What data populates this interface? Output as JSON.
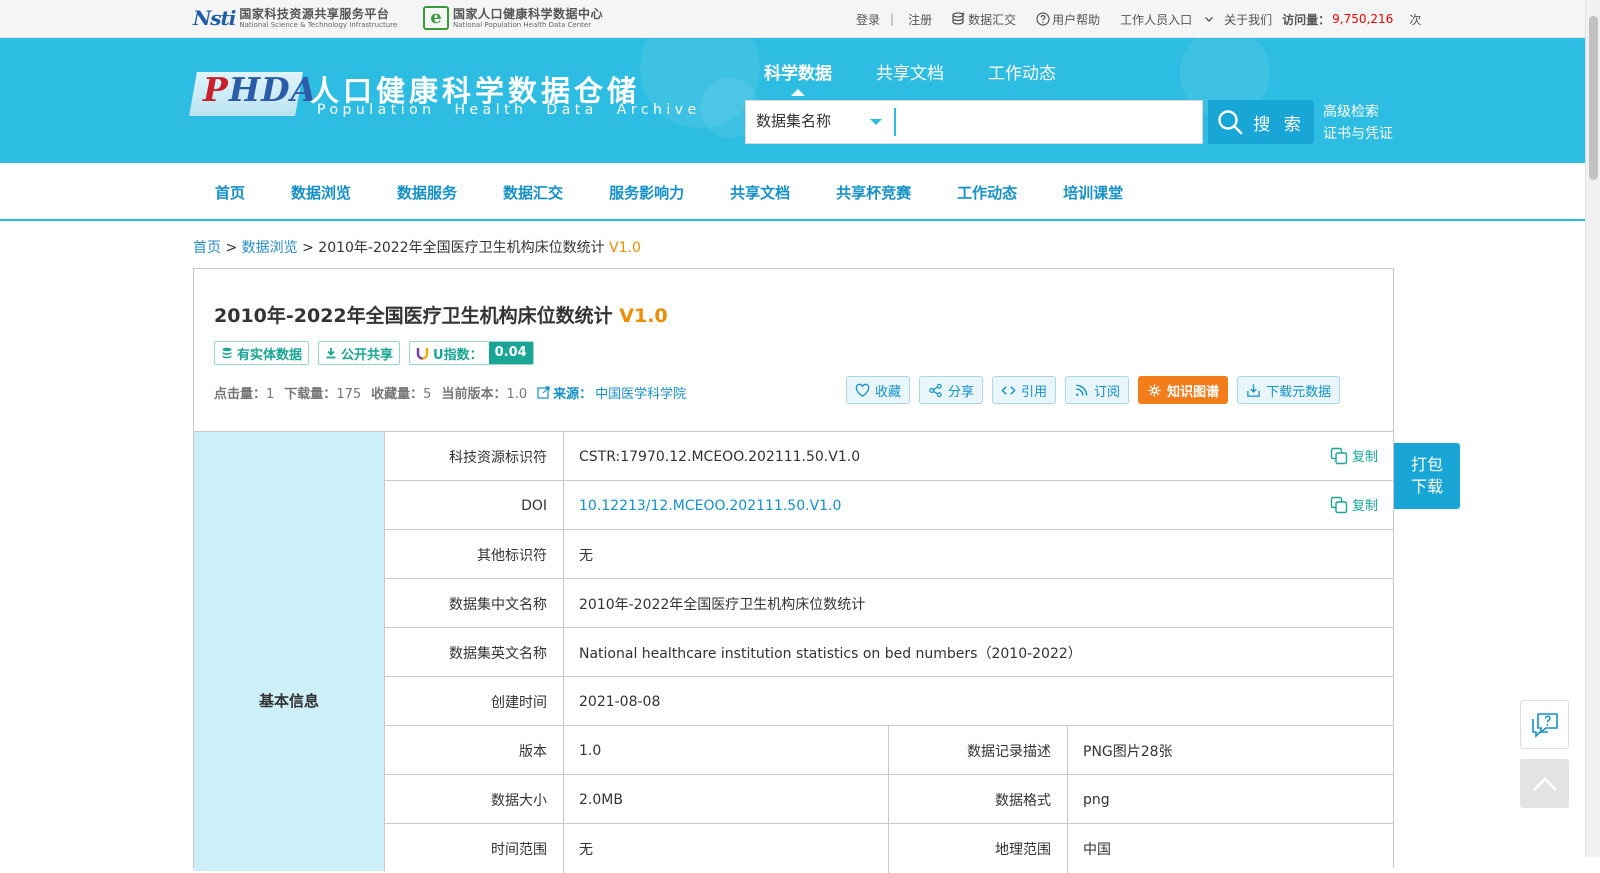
{
  "topbar": {
    "logo1": {
      "mark": "Nsti",
      "zh": "国家科技资源共享服务平台",
      "en": "National Science & Technology Infrastructure"
    },
    "logo2": {
      "mark": "e",
      "zh": "国家人口健康科学数据中心",
      "en": "National Population Health Data Center"
    },
    "login": "登录",
    "sep": "|",
    "register": "注册",
    "data_submit": "数据汇交",
    "help": "用户帮助",
    "staff": "工作人员入口",
    "about": "关于我们",
    "visits_label": "访问量：",
    "visits_value": "9,750,216",
    "visits_unit": "次"
  },
  "header": {
    "phda_p": "P",
    "phda_rest": "HDA",
    "site_zh": "人口健康科学数据仓储",
    "site_en": "Population Health Data Archive",
    "tabs": [
      "科学数据",
      "共享文档",
      "工作动态"
    ],
    "search_select": "数据集名称",
    "search_placeholder": "",
    "search_button": "搜 索",
    "advanced_search": "高级检索",
    "certificate": "证书与凭证"
  },
  "nav": [
    "首页",
    "数据浏览",
    "数据服务",
    "数据汇交",
    "服务影响力",
    "共享文档",
    "共享杯竞赛",
    "工作动态",
    "培训课堂"
  ],
  "breadcrumb": {
    "home": "首页",
    "sep": ">",
    "browse": "数据浏览",
    "current": "2010年-2022年全国医疗卫生机构床位数统计",
    "version": "V1.0"
  },
  "dataset": {
    "title": "2010年-2022年全国医疗卫生机构床位数统计",
    "version": "V1.0",
    "tags": {
      "entity": "有实体数据",
      "open": "公开共享",
      "u_label": "U指数：",
      "u_value": "0.04"
    },
    "stats": {
      "clicks_label": "点击量：",
      "clicks": "1",
      "downloads_label": "下载量：",
      "downloads": "175",
      "favorites_label": "收藏量：",
      "favorites": "5",
      "version_label": "当前版本：",
      "version": "1.0",
      "source_label": "来源：",
      "source": "中国医学科学院"
    },
    "actions": {
      "favorite": "收藏",
      "share": "分享",
      "cite": "引用",
      "subscribe": "订阅",
      "knowledge": "知识图谱",
      "download_meta": "下载元数据"
    }
  },
  "table": {
    "section": "基本信息",
    "copy": "复制",
    "rows": [
      {
        "label": "科技资源标识符",
        "value": "CSTR:17970.12.MCEOO.202111.50.V1.0"
      },
      {
        "label": "DOI",
        "value": "10.12213/12.MCEOO.202111.50.V1.0"
      },
      {
        "label": "其他标识符",
        "value": "无"
      },
      {
        "label": "数据集中文名称",
        "value": "2010年-2022年全国医疗卫生机构床位数统计"
      },
      {
        "label": "数据集英文名称",
        "value": "National healthcare institution statistics on bed numbers（2010-2022）"
      },
      {
        "label": "创建时间",
        "value": "2021-08-08"
      }
    ],
    "pairs": [
      {
        "label": "版本",
        "value": "1.0",
        "label2": "数据记录描述",
        "value2": "PNG图片28张"
      },
      {
        "label": "数据大小",
        "value": "2.0MB",
        "label2": "数据格式",
        "value2": "png"
      },
      {
        "label": "时间范围",
        "value": "无",
        "label2": "地理范围",
        "value2": "中国"
      }
    ]
  },
  "floating": {
    "pack_line1": "打包",
    "pack_line2": "下载"
  },
  "colors": {
    "header": "#2ebde2",
    "accent": "#1591c7",
    "teal": "#1aa595",
    "orange": "#f08c00",
    "kg_button": "#f47d1b"
  }
}
